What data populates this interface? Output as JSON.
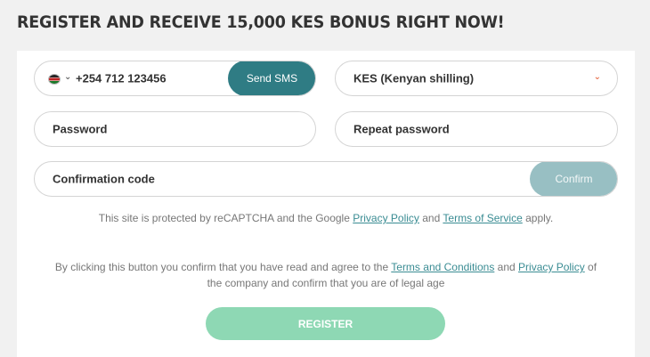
{
  "heading": "REGISTER AND RECEIVE 15,000 KES BONUS RIGHT NOW!",
  "form": {
    "phone": {
      "country_flag_icon": "kenya-flag-icon",
      "value": "+254 712 123456",
      "send_sms_label": "Send SMS"
    },
    "currency": {
      "value": "KES (Kenyan shilling)",
      "caret_icon": "chevron-down-icon"
    },
    "password_placeholder": "Password",
    "repeat_password_placeholder": "Repeat password",
    "confirmation_code_placeholder": "Confirmation code",
    "confirm_label": "Confirm",
    "recaptcha": {
      "prefix": "This site is protected by reCAPTCHA and the Google ",
      "privacy_link": "Privacy Policy",
      "and": " and ",
      "terms_link": "Terms of Service",
      "suffix": " apply."
    },
    "terms": {
      "prefix": "By clicking this button you confirm that you have read and agree to the ",
      "terms_link": "Terms and Conditions",
      "and": " and ",
      "privacy_link": "Privacy Policy",
      "suffix": " of the company and confirm that you are of legal age"
    },
    "register_label": "REGISTER"
  },
  "colors": {
    "background": "#f1f1f1",
    "send_sms_button": "#2f7c84",
    "confirm_button_disabled": "#98bfc3",
    "register_button": "#8ed8b4",
    "link": "#3a8c93",
    "caret": "#e2542b"
  }
}
